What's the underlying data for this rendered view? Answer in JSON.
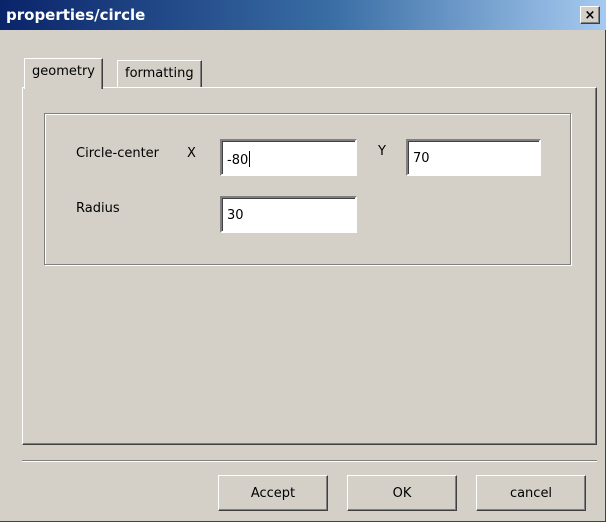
{
  "window": {
    "title": "properties/circle",
    "close_glyph": "×"
  },
  "tabs": [
    {
      "label": "geometry",
      "selected": true
    },
    {
      "label": "formatting",
      "selected": false
    }
  ],
  "geometry": {
    "circle_center_label": "Circle-center",
    "x_label": "X",
    "x_value": "-80",
    "y_label": "Y",
    "y_value": "70",
    "radius_label": "Radius",
    "radius_value": "30"
  },
  "buttons": {
    "accept": "Accept",
    "ok": "OK",
    "cancel": "cancel"
  },
  "colors": {
    "dialog_face": "#d4d0c8",
    "title_start": "#0a246a",
    "title_end": "#a6caf0"
  }
}
